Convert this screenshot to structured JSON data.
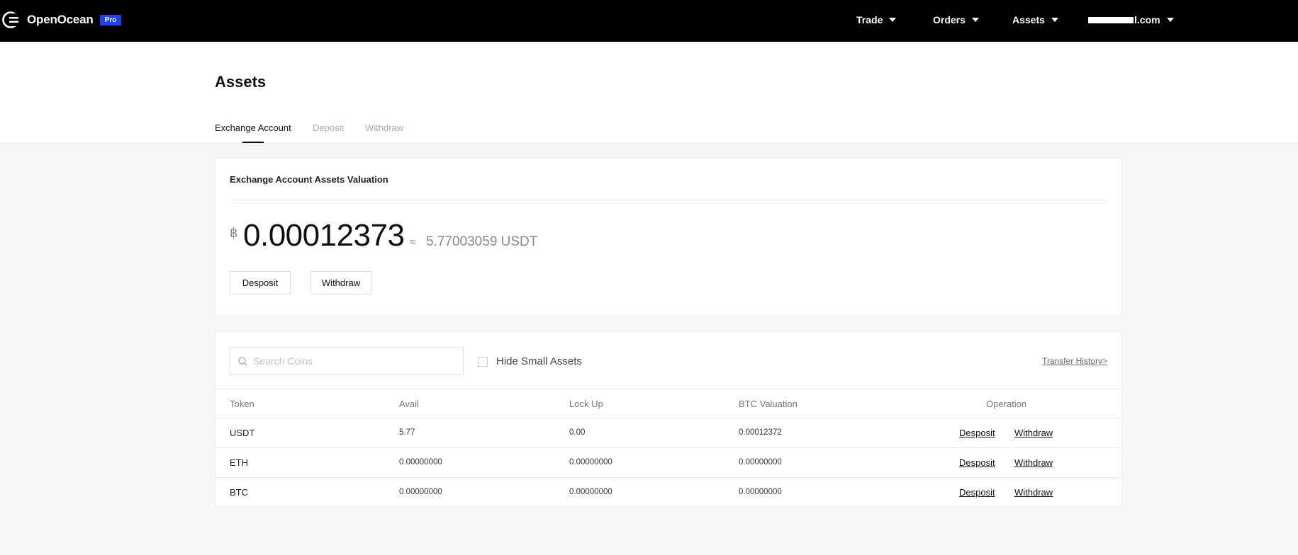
{
  "brand": {
    "name": "OpenOcean",
    "badge": "Pro"
  },
  "nav": {
    "trade": "Trade",
    "orders": "Orders",
    "assets": "Assets",
    "account_suffix": "l.com"
  },
  "page": {
    "title": "Assets",
    "tabs": [
      "Exchange Account",
      "Deposit",
      "Withdraw"
    ],
    "active_tab": "Exchange Account"
  },
  "valuation": {
    "title": "Exchange Account Assets Valuation",
    "currency_symbol": "฿",
    "btc_value": "0.00012373",
    "approx_symbol": "≈",
    "usdt_value": "5.77003059 USDT",
    "deposit_button": "Desposit",
    "withdraw_button": "Withdraw"
  },
  "assets_table": {
    "search_placeholder": "Search Coins",
    "search_value": "",
    "hide_small_label": "Hide Small Assets",
    "hide_small_checked": false,
    "transfer_history": "Transfer History>",
    "columns": [
      "Token",
      "Avail",
      "Lock Up",
      "BTC Valuation",
      "Operation"
    ],
    "rows": [
      {
        "token": "USDT",
        "avail": "5.77",
        "lockup": "0.00",
        "btc_valuation": "0.00012372",
        "deposit": "Desposit",
        "withdraw": "Withdraw"
      },
      {
        "token": "ETH",
        "avail": "0.00000000",
        "lockup": "0.00000000",
        "btc_valuation": "0.00000000",
        "deposit": "Desposit",
        "withdraw": "Withdraw"
      },
      {
        "token": "BTC",
        "avail": "0.00000000",
        "lockup": "0.00000000",
        "btc_valuation": "0.00000000",
        "deposit": "Desposit",
        "withdraw": "Withdraw"
      }
    ]
  },
  "colors": {
    "topbar": "#000000",
    "pro_badge": "#1d40f0",
    "page_background": "#f7f7f7"
  }
}
